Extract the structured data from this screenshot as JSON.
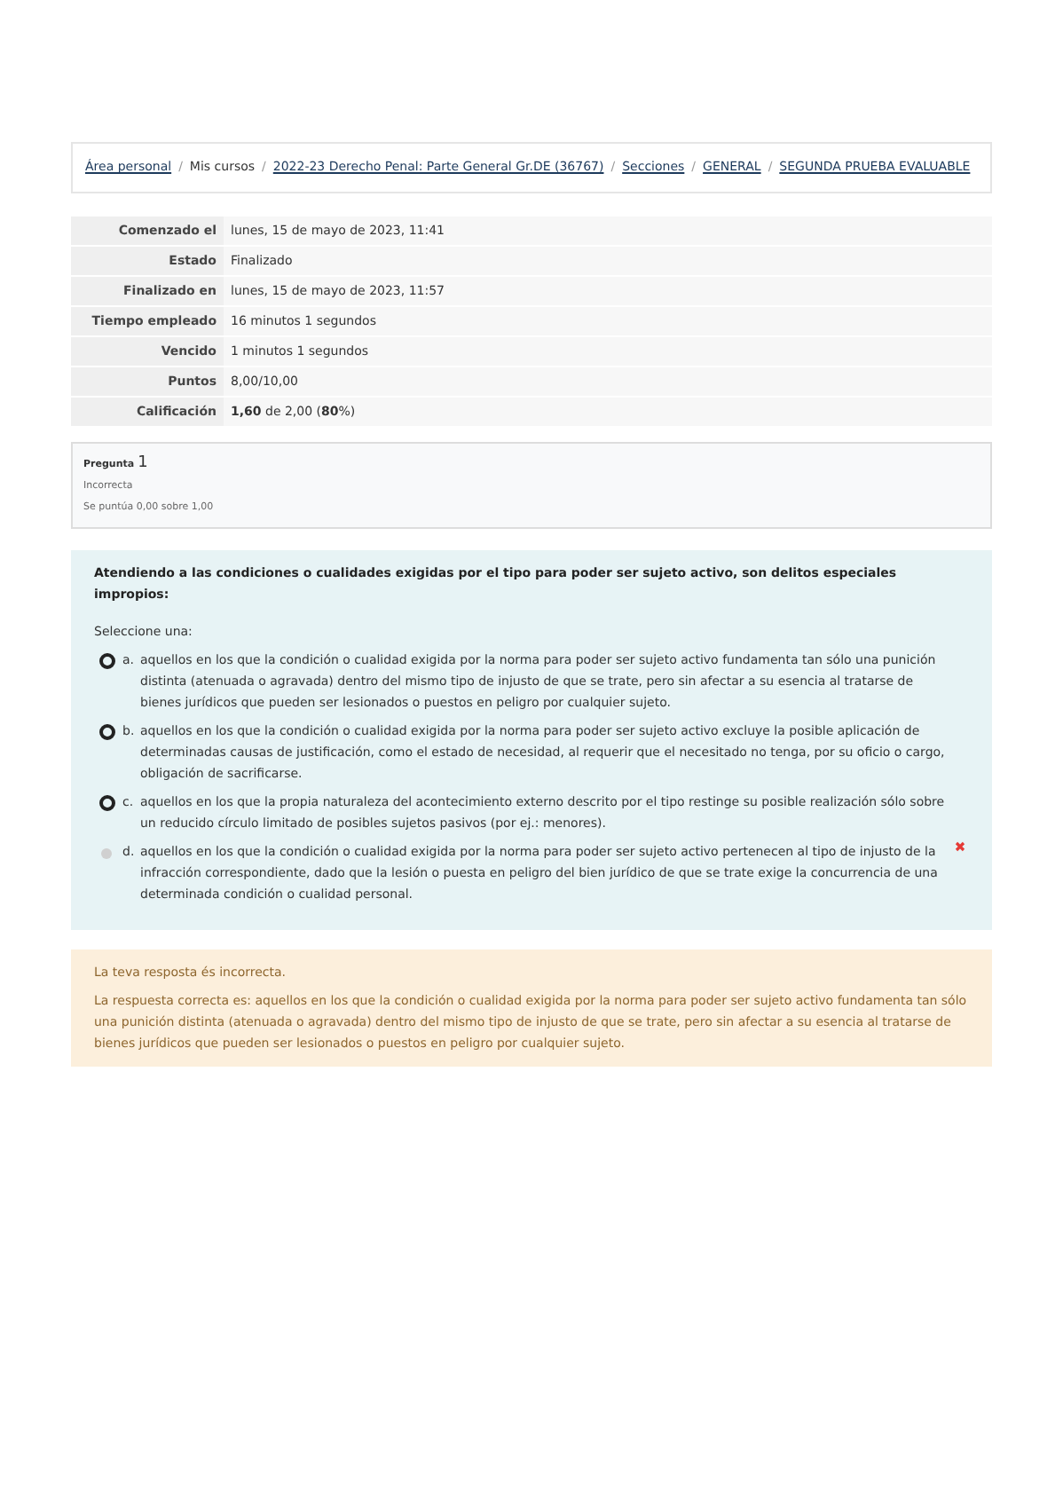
{
  "breadcrumb": [
    {
      "label": "Área personal",
      "link": true
    },
    {
      "label": "Mis cursos",
      "link": false
    },
    {
      "label": "2022-23 Derecho Penal: Parte General Gr.DE (36767)",
      "link": true
    },
    {
      "label": "Secciones",
      "link": true
    },
    {
      "label": "GENERAL",
      "link": true
    },
    {
      "label": "SEGUNDA PRUEBA EVALUABLE",
      "link": true
    }
  ],
  "separator": "/",
  "summary": [
    {
      "label": "Comenzado el",
      "value": "lunes, 15 de mayo de 2023, 11:41"
    },
    {
      "label": "Estado",
      "value": "Finalizado"
    },
    {
      "label": "Finalizado en",
      "value": "lunes, 15 de mayo de 2023, 11:57"
    },
    {
      "label": "Tiempo empleado",
      "value": "16 minutos 1 segundos"
    },
    {
      "label": "Vencido",
      "value": "1 minutos 1 segundos"
    },
    {
      "label": "Puntos",
      "value": "8,00/10,00"
    },
    {
      "label": "Calificación",
      "value": "**1,60** de 2,00 (**80**%)"
    }
  ],
  "question_info": {
    "label": "Pregunta",
    "number": "1",
    "status": "Incorrecta",
    "score": "Se puntúa 0,00 sobre 1,00"
  },
  "question": {
    "text": "Atendiendo a las condiciones o cualidades exigidas por el tipo para poder ser sujeto activo, son delitos especiales impropios:",
    "prompt": "Seleccione una:",
    "options": [
      {
        "letter": "a.",
        "text": "aquellos en los que la condición o cualidad exigida por la norma para poder ser sujeto activo fundamenta tan sólo una punición distinta (atenuada o agravada) dentro del mismo tipo de injusto de que se trate, pero sin afectar a su esencia al tratarse de bienes jurídicos que pueden ser lesionados o puestos en peligro por cualquier sujeto.",
        "selected": false,
        "incorrect": false
      },
      {
        "letter": "b.",
        "text": "aquellos en los que la condición o cualidad exigida por la norma para poder ser sujeto activo excluye la posible aplicación de determinadas causas de justificación, como el estado de necesidad, al requerir que el necesitado no tenga, por su oficio o cargo, obligación de sacrificarse.",
        "selected": false,
        "incorrect": false
      },
      {
        "letter": "c.",
        "text": "aquellos en los que la propia naturaleza del acontecimiento externo descrito por el tipo restinge su posible realización sólo sobre un reducido círculo limitado de posibles sujetos pasivos (por ej.: menores).",
        "selected": false,
        "incorrect": false
      },
      {
        "letter": "d.",
        "text": "aquellos en los que la condición o cualidad exigida por la norma para poder ser sujeto activo pertenecen al tipo de injusto de la infracción correspondiente, dado que la lesión o puesta en peligro del bien jurídico de que se trate exige la concurrencia de una determinada condición o cualidad personal.",
        "selected": true,
        "incorrect": true
      }
    ]
  },
  "feedback": {
    "verdict": "La teva resposta és incorrecta.",
    "answer": "La respuesta correcta es: aquellos en los que la condición o cualidad exigida por la norma para poder ser sujeto activo fundamenta tan sólo una punición distinta (atenuada o agravada) dentro del mismo tipo de injusto de que se trate, pero sin afectar a su esencia al tratarse de bienes jurídicos que pueden ser lesionados o puestos en peligro por cualquier sujeto."
  }
}
